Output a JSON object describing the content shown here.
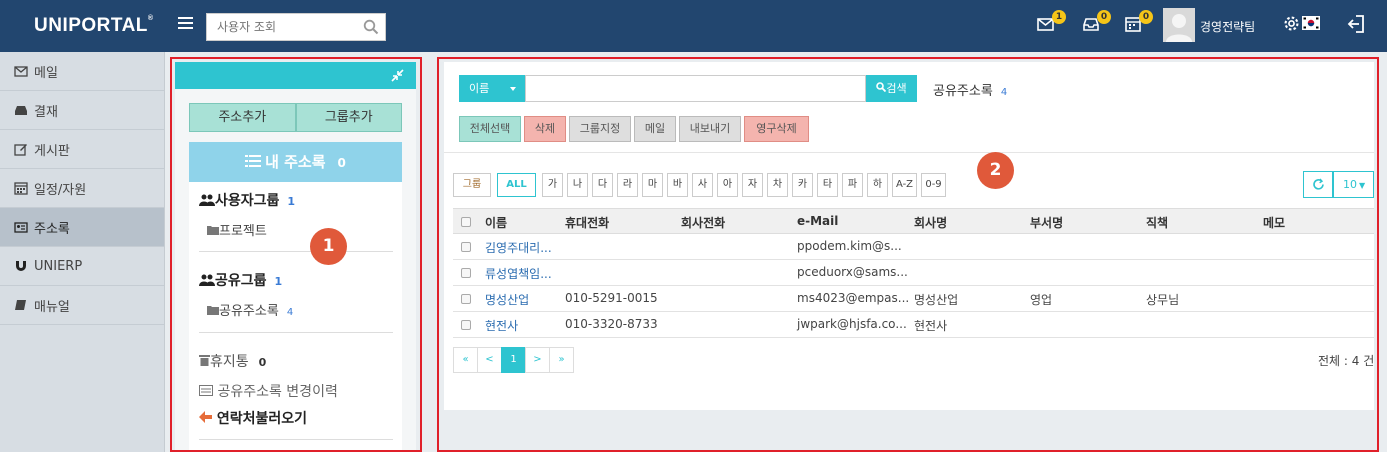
{
  "app": {
    "logo": "UNIPORTAL",
    "logo_mark": "®"
  },
  "header": {
    "search_placeholder": "사용자 조회",
    "mail_badge": "1",
    "approval_badge": "0",
    "schedule_badge": "0",
    "user_name": "경영전략팀"
  },
  "sidebar": {
    "items": [
      {
        "label": "메일",
        "icon": "mail-icon"
      },
      {
        "label": "결재",
        "icon": "inbox-icon"
      },
      {
        "label": "게시판",
        "icon": "edit-icon"
      },
      {
        "label": "일정/자원",
        "icon": "calendar-icon"
      },
      {
        "label": "주소록",
        "icon": "addressbook-icon",
        "active": true
      },
      {
        "label": "UNIERP",
        "icon": "magnet-icon"
      },
      {
        "label": "매뉴얼",
        "icon": "book-icon"
      }
    ]
  },
  "panel1": {
    "add_address": "주소추가",
    "add_group": "그룹추가",
    "my_book": "내 주소록",
    "my_book_count": "0",
    "user_group": "사용자그룹",
    "user_group_count": "1",
    "project": "프로젝트",
    "shared_group": "공유그룹",
    "shared_group_count": "1",
    "shared_book": "공유주소록",
    "shared_book_count": "4",
    "trash": "휴지통",
    "trash_count": "0",
    "history": "공유주소록 변경이력",
    "import": "연락처불러오기",
    "marker": "1"
  },
  "panel2": {
    "search_field": "이름",
    "search_button": "검색",
    "title": "공유주소록",
    "title_count": "4",
    "actions": [
      "전체선택",
      "삭제",
      "그룹지정",
      "메일",
      "내보내기",
      "영구삭제"
    ],
    "group_filter": "그룹",
    "filters": [
      "ALL",
      "가",
      "나",
      "다",
      "라",
      "마",
      "바",
      "사",
      "아",
      "자",
      "차",
      "카",
      "타",
      "파",
      "하",
      "A-Z",
      "0-9"
    ],
    "page_size": "10",
    "marker": "2",
    "columns": [
      "이름",
      "휴대전화",
      "회사전화",
      "e-Mail",
      "회사명",
      "부서명",
      "직책",
      "메모"
    ],
    "rows": [
      [
        "김영주대리...",
        "",
        "",
        "ppodem.kim@s...",
        "",
        "",
        "",
        ""
      ],
      [
        "류성엽책임...",
        "",
        "",
        "pceduorx@sams...",
        "",
        "",
        "",
        ""
      ],
      [
        "명성산업",
        "010-5291-0015",
        "",
        "ms4023@empas...",
        "명성산업",
        "영업",
        "상무님",
        ""
      ],
      [
        "현전사",
        "010-3320-8733",
        "",
        "jwpark@hjsfa.co...",
        "현전사",
        "",
        "",
        ""
      ]
    ],
    "pager": [
      "«",
      "<",
      "1",
      ">",
      "»"
    ],
    "total": "전체 : 4 건"
  },
  "colors": {
    "header": "#22466f",
    "accent": "#2ec4d0",
    "highlight": "#e0202a"
  }
}
